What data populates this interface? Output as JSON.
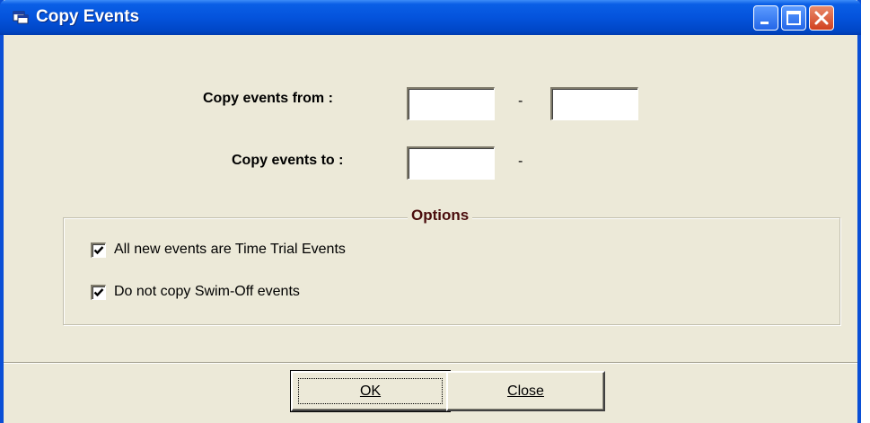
{
  "window": {
    "title": "Copy Events",
    "icon": "app-window-icon",
    "controls": [
      "minimize-icon",
      "maximize-icon",
      "close-icon"
    ]
  },
  "form": {
    "copy_from_label": "Copy events from :",
    "copy_from_start": "",
    "copy_from_end": "",
    "range_dash": "-",
    "copy_to_label": "Copy events to :",
    "copy_to_value": "",
    "copy_to_dash": "-"
  },
  "options": {
    "title": "Options",
    "items": [
      {
        "label": "All new events are Time Trial Events",
        "checked": true
      },
      {
        "label": "Do not copy Swim-Off events",
        "checked": true
      }
    ]
  },
  "buttons": {
    "ok_label": "OK",
    "close_label": "Close"
  },
  "colors": {
    "titlebar": "#0453dc",
    "face": "#ece9d8",
    "group_title": "#4a0d0d"
  }
}
